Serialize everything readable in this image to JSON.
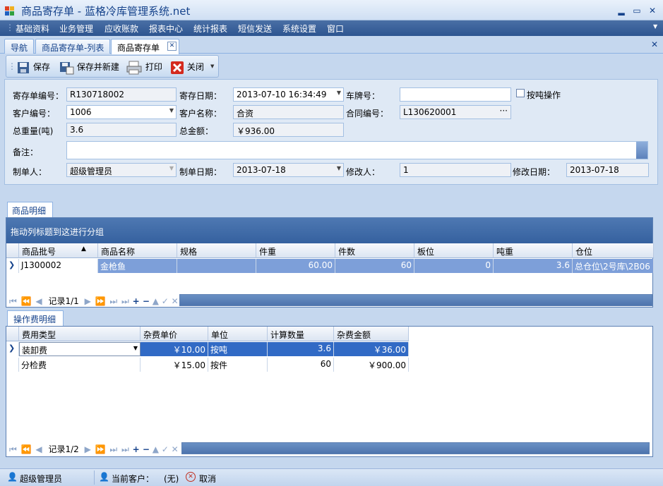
{
  "window": {
    "title": "商品寄存单 - 蓝格冷库管理系统.net"
  },
  "menu": [
    "基础资料",
    "业务管理",
    "应收账款",
    "报表中心",
    "统计报表",
    "短信发送",
    "系统设置",
    "窗口"
  ],
  "tabs": [
    {
      "label": "导航"
    },
    {
      "label": "商品寄存单-列表"
    },
    {
      "label": "商品寄存单",
      "active": true
    }
  ],
  "toolbar": {
    "save": "保存",
    "save_new": "保存并新建",
    "print": "打印",
    "close": "关闭"
  },
  "form": {
    "deposit_no_label": "寄存单编号：",
    "deposit_no": "R130718002",
    "deposit_date_label": "寄存日期：",
    "deposit_date": "2013-07-10  16:34:49",
    "plate_label": "车牌号：",
    "plate": "",
    "by_ton_label": "按吨操作",
    "customer_no_label": "客户编号：",
    "customer_no": "1006",
    "customer_name_label": "客户名称：",
    "customer_name": "合资",
    "contract_no_label": "合同编号：",
    "contract_no": "L130620001",
    "total_weight_label": "总重量(吨)",
    "total_weight": "3.6",
    "total_amount_label": "总金额：",
    "total_amount": "￥936.00",
    "remark_label": "备注：",
    "remark": "",
    "creator_label": "制单人：",
    "creator": "超级管理员",
    "create_date_label": "制单日期：",
    "create_date": "2013-07-18",
    "modifier_label": "修改人：",
    "modifier": "1",
    "modify_date_label": "修改日期：",
    "modify_date": "2013-07-18"
  },
  "goods": {
    "tab_label": "商品明细",
    "group_hint": "拖动列标题到这进行分组",
    "columns": [
      "商品批号",
      "商品名称",
      "规格",
      "件重",
      "件数",
      "板位",
      "吨重",
      "仓位"
    ],
    "rows": [
      [
        "J1300002",
        "金枪鱼",
        "",
        "60.00",
        "60",
        "0",
        "3.6",
        "总仓位\\2号库\\2B06"
      ]
    ],
    "record": "记录1/1"
  },
  "fees": {
    "tab_label": "操作费明细",
    "columns": [
      "费用类型",
      "杂费单价",
      "单位",
      "计算数量",
      "杂费金额"
    ],
    "rows": [
      [
        "装卸费",
        "￥10.00",
        "按吨",
        "3.6",
        "￥36.00"
      ],
      [
        "分检费",
        "￥15.00",
        "按件",
        "60",
        "￥900.00"
      ]
    ],
    "record": "记录1/2"
  },
  "status": {
    "user": "超级管理员",
    "current_customer_label": "当前客户：",
    "current_customer": "(无)",
    "cancel": "取消"
  },
  "colors": {
    "menu_bg": "#2d5590",
    "group_bar": "#35619f",
    "selected_row": "#7d9fd9",
    "accent_text": "#15428b"
  }
}
